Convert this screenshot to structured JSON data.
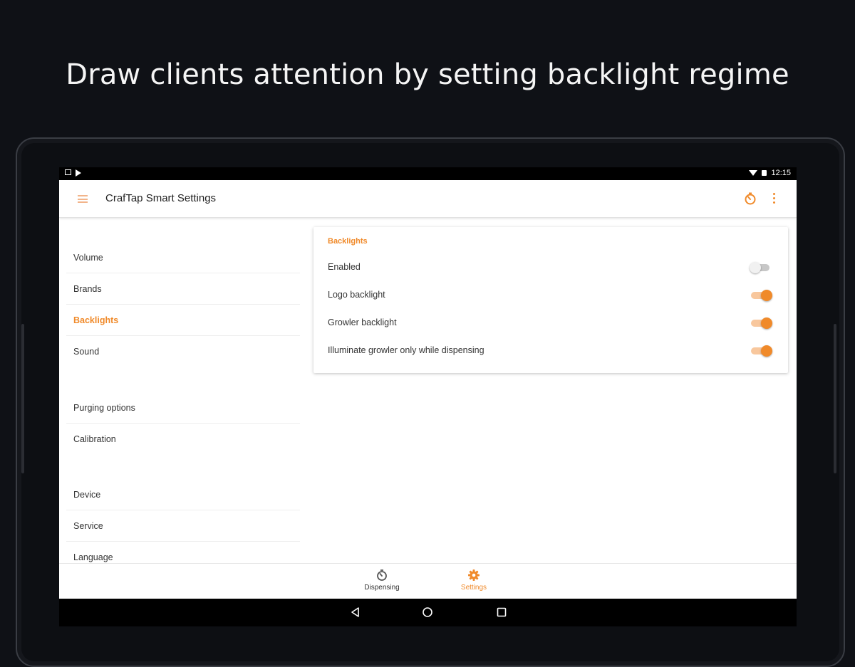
{
  "promo": {
    "title": "Draw clients attention by setting backlight regime"
  },
  "status_bar": {
    "time": "12:15"
  },
  "app_bar": {
    "title": "CrafTap Smart Settings"
  },
  "sidebar": {
    "items": [
      {
        "label": "Volume"
      },
      {
        "label": "Brands"
      },
      {
        "label": "Backlights"
      },
      {
        "label": "Sound"
      },
      {
        "label": "Purging options"
      },
      {
        "label": "Calibration"
      },
      {
        "label": "Device"
      },
      {
        "label": "Service"
      },
      {
        "label": "Language"
      }
    ],
    "active": "Backlights"
  },
  "backlights": {
    "header": "Backlights",
    "settings": [
      {
        "label": "Enabled",
        "on": false
      },
      {
        "label": "Logo backlight",
        "on": true
      },
      {
        "label": "Growler backlight",
        "on": true
      },
      {
        "label": "Illuminate growler only while dispensing",
        "on": true
      }
    ]
  },
  "bottom_nav": {
    "tabs": [
      {
        "label": "Dispensing",
        "icon": "timer-icon"
      },
      {
        "label": "Settings",
        "icon": "gear-icon"
      }
    ],
    "active": "Settings"
  },
  "colors": {
    "accent": "#f08a2a",
    "accent_light": "#f8c79d",
    "background": "#0f1116"
  }
}
